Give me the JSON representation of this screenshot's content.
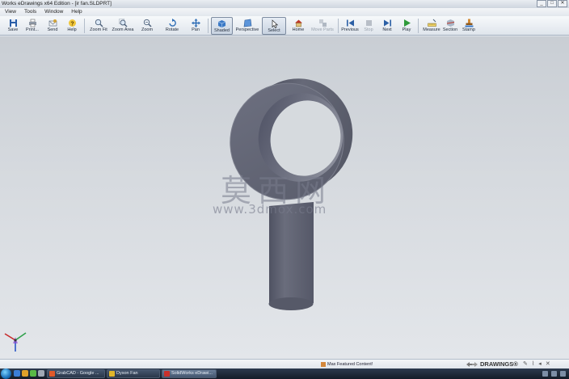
{
  "window": {
    "title": "Works eDrawings x64 Edition - [ir fan.SLDPRT]",
    "controls": [
      "_",
      "□",
      "✕"
    ]
  },
  "menu": [
    "View",
    "Tools",
    "Window",
    "Help"
  ],
  "toolbar": [
    {
      "label": "Save",
      "icon": "save-icon"
    },
    {
      "label": "Print...",
      "icon": "print-icon"
    },
    {
      "label": "Send",
      "icon": "send-icon"
    },
    {
      "label": "Help",
      "icon": "help-icon"
    },
    {
      "label": "Zoom Fit",
      "icon": "zoom-fit-icon"
    },
    {
      "label": "Zoom Area",
      "icon": "zoom-area-icon"
    },
    {
      "label": "Zoom",
      "icon": "zoom-icon"
    },
    {
      "label": "Rotate",
      "icon": "rotate-icon"
    },
    {
      "label": "Pan",
      "icon": "pan-icon"
    },
    {
      "label": "Shaded",
      "icon": "shaded-icon",
      "active": true
    },
    {
      "label": "Perspective",
      "icon": "perspective-icon"
    },
    {
      "label": "Select",
      "icon": "select-icon",
      "active": true
    },
    {
      "label": "Home",
      "icon": "home-icon"
    },
    {
      "label": "Move Parts",
      "icon": "move-parts-icon",
      "disabled": true
    },
    {
      "label": "Previous",
      "icon": "previous-icon"
    },
    {
      "label": "Stop",
      "icon": "stop-icon",
      "disabled": true
    },
    {
      "label": "Next",
      "icon": "next-icon"
    },
    {
      "label": "Play",
      "icon": "play-icon"
    },
    {
      "label": "Measure",
      "icon": "measure-icon"
    },
    {
      "label": "Section",
      "icon": "section-icon"
    },
    {
      "label": "Stamp",
      "icon": "stamp-icon"
    }
  ],
  "watermark": {
    "cn": "莫西网",
    "url": "www.3dmox.com"
  },
  "status": {
    "link": "Max Featured Content!",
    "logo": "DRAWINGS®"
  },
  "taskbar": {
    "tasks": [
      {
        "label": "GrabCAD - Google ...",
        "active": false
      },
      {
        "label": "Dyson Fan",
        "active": false
      },
      {
        "label": "SolidWorks eDrawi...",
        "active": true
      }
    ]
  },
  "colors": {
    "model": "#5f6272",
    "toolbar": "#e8ecf1",
    "accent": "#1a6fb8"
  }
}
